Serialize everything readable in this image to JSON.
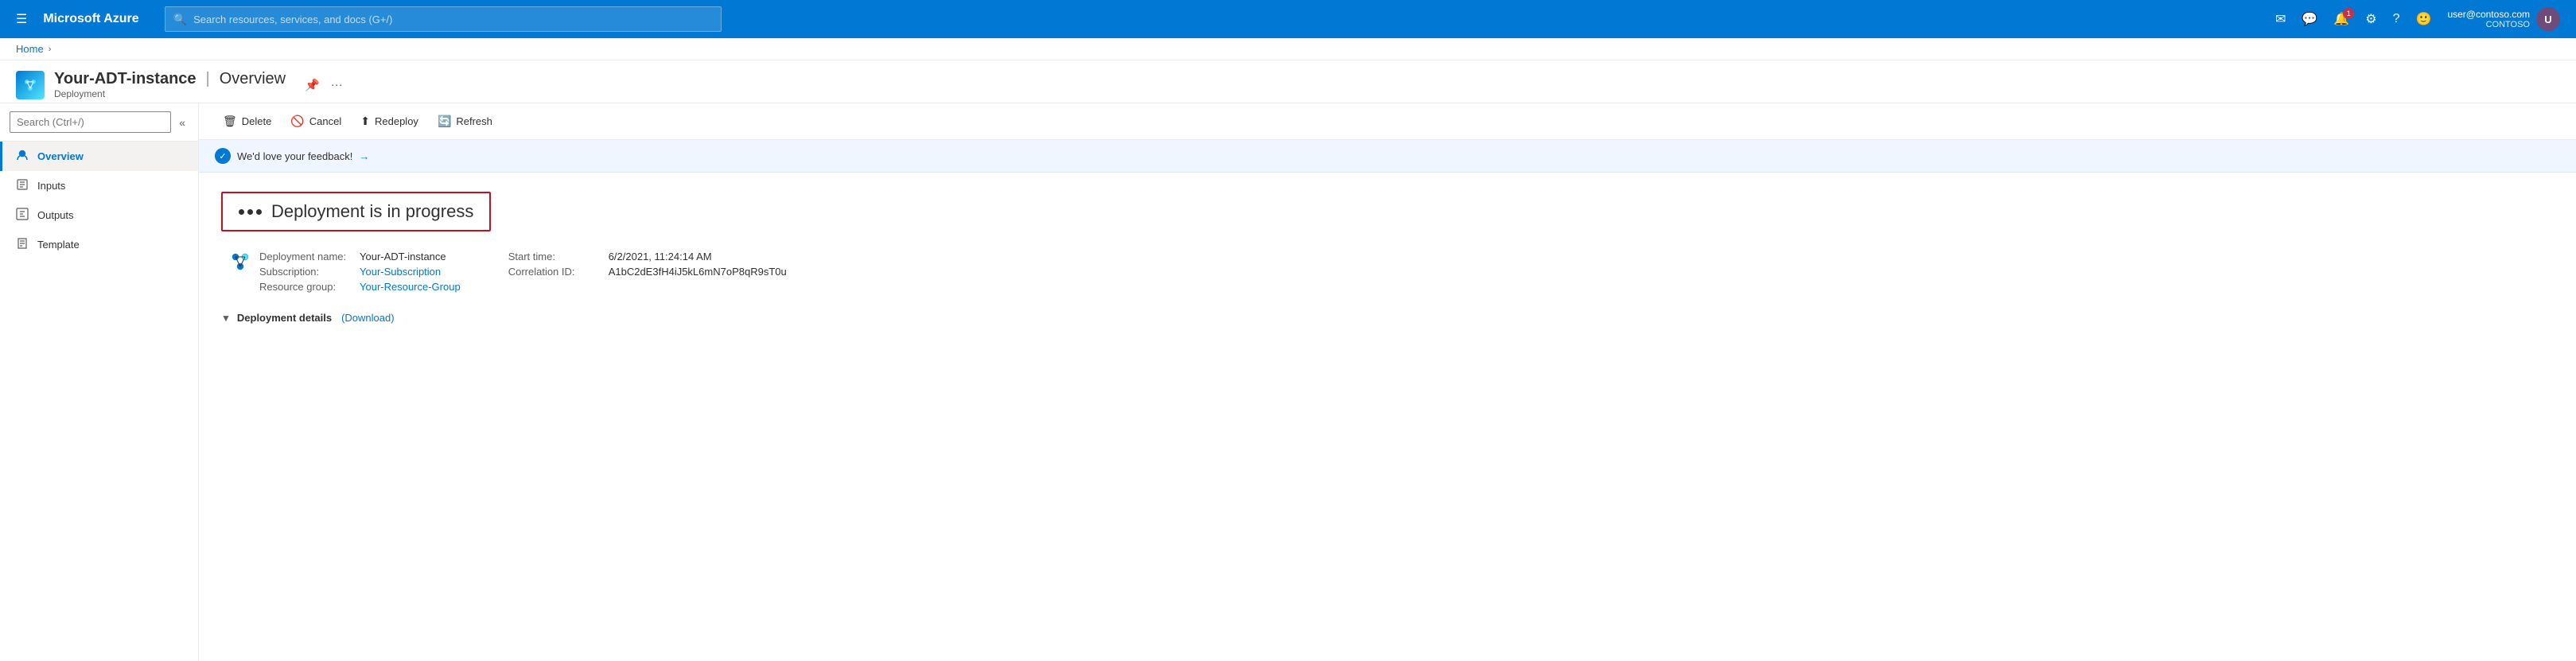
{
  "topNav": {
    "brand": "Microsoft Azure",
    "searchPlaceholder": "Search resources, services, and docs (G+/)",
    "user": {
      "email": "user@contoso.com",
      "org": "CONTOSO"
    },
    "notificationCount": "1"
  },
  "breadcrumb": {
    "home": "Home"
  },
  "pageHeader": {
    "title": "Your-ADT-instance",
    "subtitle": "Deployment",
    "separator": "|",
    "viewName": "Overview"
  },
  "sidebar": {
    "searchPlaceholder": "Search (Ctrl+/)",
    "items": [
      {
        "id": "overview",
        "label": "Overview",
        "icon": "👤",
        "active": true
      },
      {
        "id": "inputs",
        "label": "Inputs",
        "icon": "📥"
      },
      {
        "id": "outputs",
        "label": "Outputs",
        "icon": "📤"
      },
      {
        "id": "template",
        "label": "Template",
        "icon": "📄"
      }
    ]
  },
  "toolbar": {
    "deleteLabel": "Delete",
    "cancelLabel": "Cancel",
    "redeployLabel": "Redeploy",
    "refreshLabel": "Refresh"
  },
  "feedbackBar": {
    "text": "We'd love your feedback!",
    "arrowIcon": "→"
  },
  "deployment": {
    "statusTitle": "Deployment is in progress",
    "nameLabel": "Deployment name:",
    "nameValue": "Your-ADT-instance",
    "subscriptionLabel": "Subscription:",
    "subscriptionValue": "Your-Subscription",
    "resourceGroupLabel": "Resource group:",
    "resourceGroupValue": "Your-Resource-Group",
    "startTimeLabel": "Start time:",
    "startTimeValue": "6/2/2021, 11:24:14 AM",
    "correlationLabel": "Correlation ID:",
    "correlationValue": "A1bC2dE3fH4iJ5kL6mN7oP8qR9sT0u",
    "detailsLabel": "Deployment details",
    "downloadLabel": "(Download)"
  }
}
